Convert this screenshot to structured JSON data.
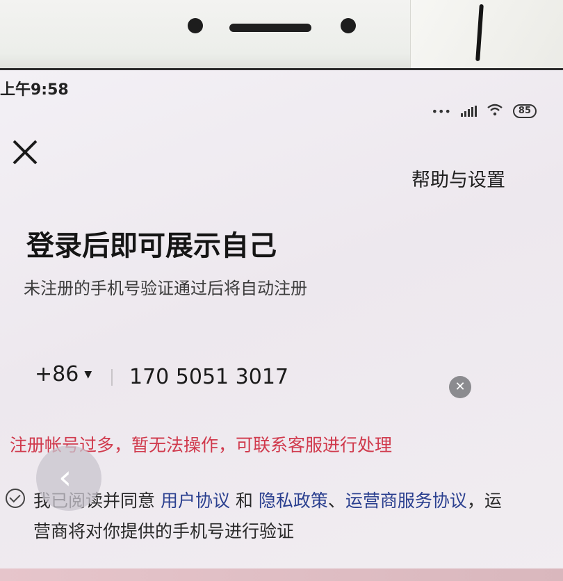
{
  "status_bar": {
    "time": "上午9:58",
    "battery": "85"
  },
  "header": {
    "help_label": "帮助与设置"
  },
  "login": {
    "title": "登录后即可展示自己",
    "subtitle": "未注册的手机号验证通过后将自动注册",
    "country_code": "+86",
    "phone_value": "170 5051 3017",
    "error": "注册帐号过多，暂无法操作，可联系客服进行处理"
  },
  "agreement": {
    "prefix": "我已阅读并同意 ",
    "user_agreement": "用户协议",
    "and": " 和 ",
    "privacy": "隐私政策",
    "sep": "、",
    "carrier": "运营商服务协议",
    "suffix": "，运营商将对你提供的手机号进行验证"
  },
  "colors": {
    "error": "#d0394c",
    "link": "#2a3f8f"
  }
}
